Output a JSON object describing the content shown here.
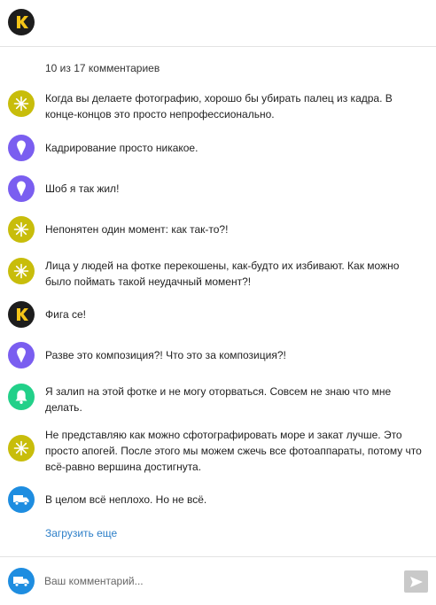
{
  "header": {
    "logo_letter": "K",
    "logo_icon": "k-logo-icon"
  },
  "comments_count_label": "10 из 17 комментариев",
  "comments": [
    {
      "avatar": "snowflake-icon",
      "avatar_color": "#c8bd0b",
      "text": "Когда вы делаете фотографию, хорошо бы убирать палец из кадра. В конце-концов это просто непрофессионально."
    },
    {
      "avatar": "ice-cream-icon",
      "avatar_color": "#7a5ef0",
      "text": "Кадрирование просто никакое."
    },
    {
      "avatar": "ice-cream-icon",
      "avatar_color": "#7a5ef0",
      "text": "Шоб я так жил!"
    },
    {
      "avatar": "snowflake-icon",
      "avatar_color": "#c8bd0b",
      "text": "Непонятен один момент: как так-то?!"
    },
    {
      "avatar": "snowflake-icon",
      "avatar_color": "#c8bd0b",
      "text": "Лица у людей на фотке перекошены, как-будто их избивают. Как можно было поймать такой неудачный момент?!"
    },
    {
      "avatar": "k-logo-icon",
      "avatar_color": "#1d1d1d",
      "text": "Фига се!"
    },
    {
      "avatar": "ice-cream-icon",
      "avatar_color": "#7a5ef0",
      "text": "Разве это композиция?! Что это за композиция?!"
    },
    {
      "avatar": "bell-icon",
      "avatar_color": "#22d089",
      "text": "Я залип на этой фотке и не могу оторваться. Совсем не знаю что мне делать."
    },
    {
      "avatar": "snowflake-icon",
      "avatar_color": "#c8bd0b",
      "text": "Не представляю как можно сфотографировать море и закат лучше. Это просто апогей. После этого мы можем сжечь все фотоаппараты, потому что всё-равно вершина достигнута."
    },
    {
      "avatar": "truck-icon",
      "avatar_color": "#1e8de0",
      "text": "В целом всё неплохо. Но не всё."
    }
  ],
  "load_more_label": "Загрузить еще",
  "composer": {
    "avatar": "truck-icon",
    "placeholder": "Ваш комментарий...",
    "value": "",
    "send_icon": "send-icon"
  },
  "colors": {
    "link": "#2d7fc8",
    "logo_yellow": "#f5c518",
    "send_button": "#c9c9c9"
  }
}
